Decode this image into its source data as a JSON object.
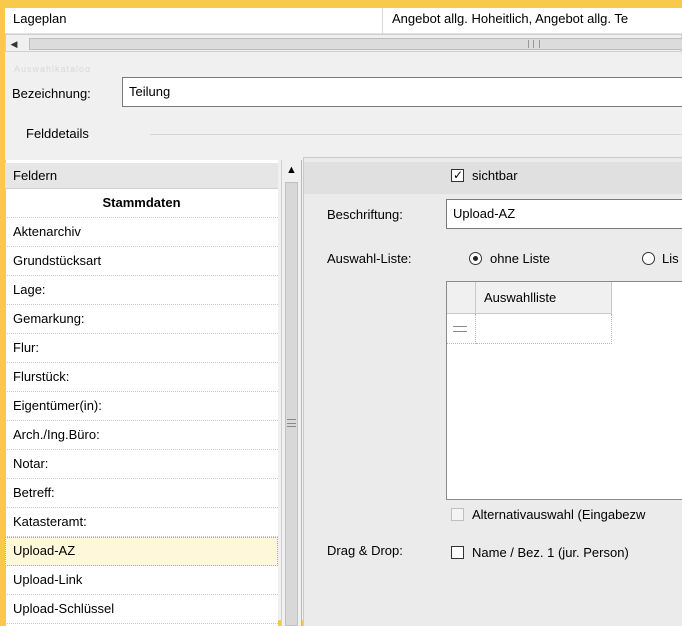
{
  "top_table": {
    "cell1": "Lageplan",
    "cell2": "Angebot allg. Hoheitlich, Angebot allg. Te"
  },
  "faint_label": "Auswahlkatalog",
  "bezeichnung": {
    "label": "Bezeichnung:",
    "value": "Teilung"
  },
  "felddetails": {
    "label": "Felddetails"
  },
  "fields_list": {
    "header": "Feldern",
    "items": [
      {
        "label": "Stammdaten",
        "type": "section"
      },
      {
        "label": "Aktenarchiv"
      },
      {
        "label": "Grundstücksart"
      },
      {
        "label": "Lage:"
      },
      {
        "label": "Gemarkung:"
      },
      {
        "label": "Flur:"
      },
      {
        "label": "Flurstück:"
      },
      {
        "label": "Eigentümer(in):"
      },
      {
        "label": "Arch./Ing.Büro:"
      },
      {
        "label": "Notar:"
      },
      {
        "label": "Betreff:"
      },
      {
        "label": "Katasteramt:"
      },
      {
        "label": "Upload-AZ",
        "selected": true
      },
      {
        "label": "Upload-Link"
      },
      {
        "label": "Upload-Schlüssel"
      }
    ]
  },
  "details": {
    "sichtbar": {
      "label": "sichtbar",
      "checked": true
    },
    "beschriftung": {
      "label": "Beschriftung:",
      "value": "Upload-AZ"
    },
    "auswahl_liste": {
      "label": "Auswahl-Liste:",
      "option_ohne": "ohne Liste",
      "option_liste": "Lis"
    },
    "grid": {
      "column_header": "Auswahlliste"
    },
    "alternativauswahl": {
      "label": "Alternativauswahl (Eingabezw",
      "enabled": false
    },
    "drag_drop": {
      "label": "Drag & Drop:",
      "checkbox_label": "Name / Bez. 1 (jur. Person)",
      "checked": false
    }
  },
  "icons": {
    "scroll_left": "chevron-left-icon",
    "scroll_up": "chevron-up-icon",
    "new_row": "new-row-icon"
  },
  "colors": {
    "frame": "#f8c94a",
    "selected_row": "#fff7d9"
  }
}
